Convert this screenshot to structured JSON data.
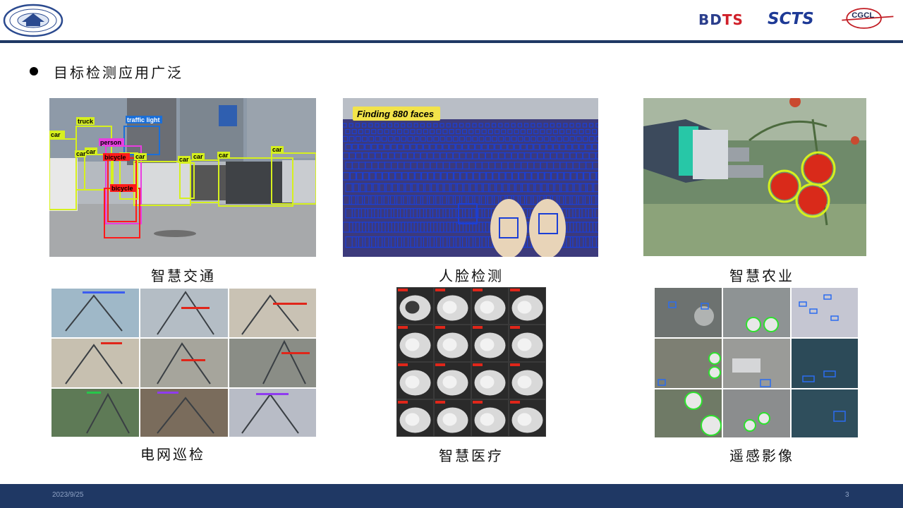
{
  "header": {
    "logos": {
      "bdts_prefix": "BD",
      "bdts_suffix": "TS",
      "scts": "SCTS",
      "cgcl": "CGCL"
    }
  },
  "bullet": {
    "text": "目标检测应用广泛"
  },
  "panels": {
    "traffic": {
      "caption": "智慧交通",
      "labels": [
        "car",
        "truck",
        "traffic light",
        "car",
        "person",
        "car",
        "bicycle",
        "car",
        "car",
        "car",
        "car",
        "bicycle",
        "car"
      ]
    },
    "faces": {
      "caption": "人脸检测",
      "banner": "Finding 880 faces"
    },
    "agriculture": {
      "caption": "智慧农业"
    },
    "power": {
      "caption": "电网巡检"
    },
    "medical": {
      "caption": "智慧医疗"
    },
    "remote": {
      "caption": "遥感影像"
    }
  },
  "footer": {
    "date": "2023/9/25",
    "page": "3"
  },
  "colors": {
    "brand_navy": "#1f3864",
    "detection_yellow": "#d6f01e",
    "detection_red": "#ff1a1a",
    "face_box_blue": "#1b3fd6"
  }
}
